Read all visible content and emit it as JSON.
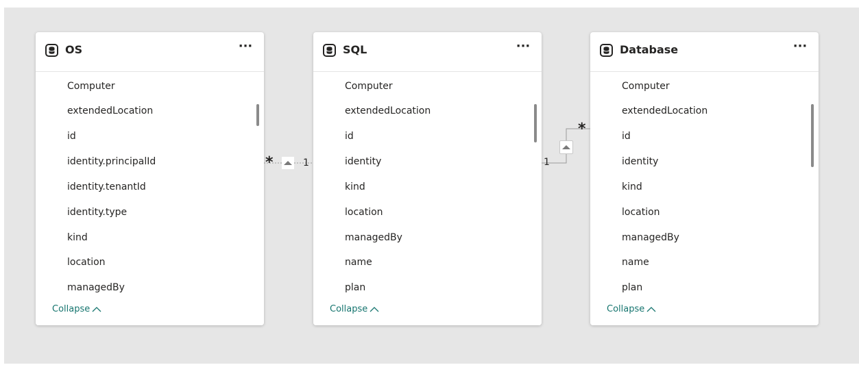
{
  "tables": [
    {
      "name": "OS",
      "fields": [
        "Computer",
        "extendedLocation",
        "id",
        "identity.principalId",
        "identity.tenantId",
        "identity.type",
        "kind",
        "location",
        "managedBy"
      ],
      "collapse_label": "Collapse",
      "more_label": "···"
    },
    {
      "name": "SQL",
      "fields": [
        "Computer",
        "extendedLocation",
        "id",
        "identity",
        "kind",
        "location",
        "managedBy",
        "name",
        "plan"
      ],
      "collapse_label": "Collapse",
      "more_label": "···"
    },
    {
      "name": "Database",
      "fields": [
        "Computer",
        "extendedLocation",
        "id",
        "identity",
        "kind",
        "location",
        "managedBy",
        "name",
        "plan"
      ],
      "collapse_label": "Collapse",
      "more_label": "···"
    }
  ],
  "relationships": [
    {
      "from_table": "OS",
      "to_table": "SQL",
      "from_cardinality": "*",
      "to_cardinality": "1"
    },
    {
      "from_table": "SQL",
      "to_table": "Database",
      "from_cardinality": "1",
      "to_cardinality": "*"
    }
  ],
  "icons": {
    "table": "database-icon",
    "more": "more-options-icon",
    "collapse": "chevron-up-icon",
    "filter_direction": "triangle-up-icon"
  },
  "colors": {
    "canvas": "#e6e6e6",
    "card": "#ffffff",
    "text": "#252423",
    "link": "#16756f"
  }
}
